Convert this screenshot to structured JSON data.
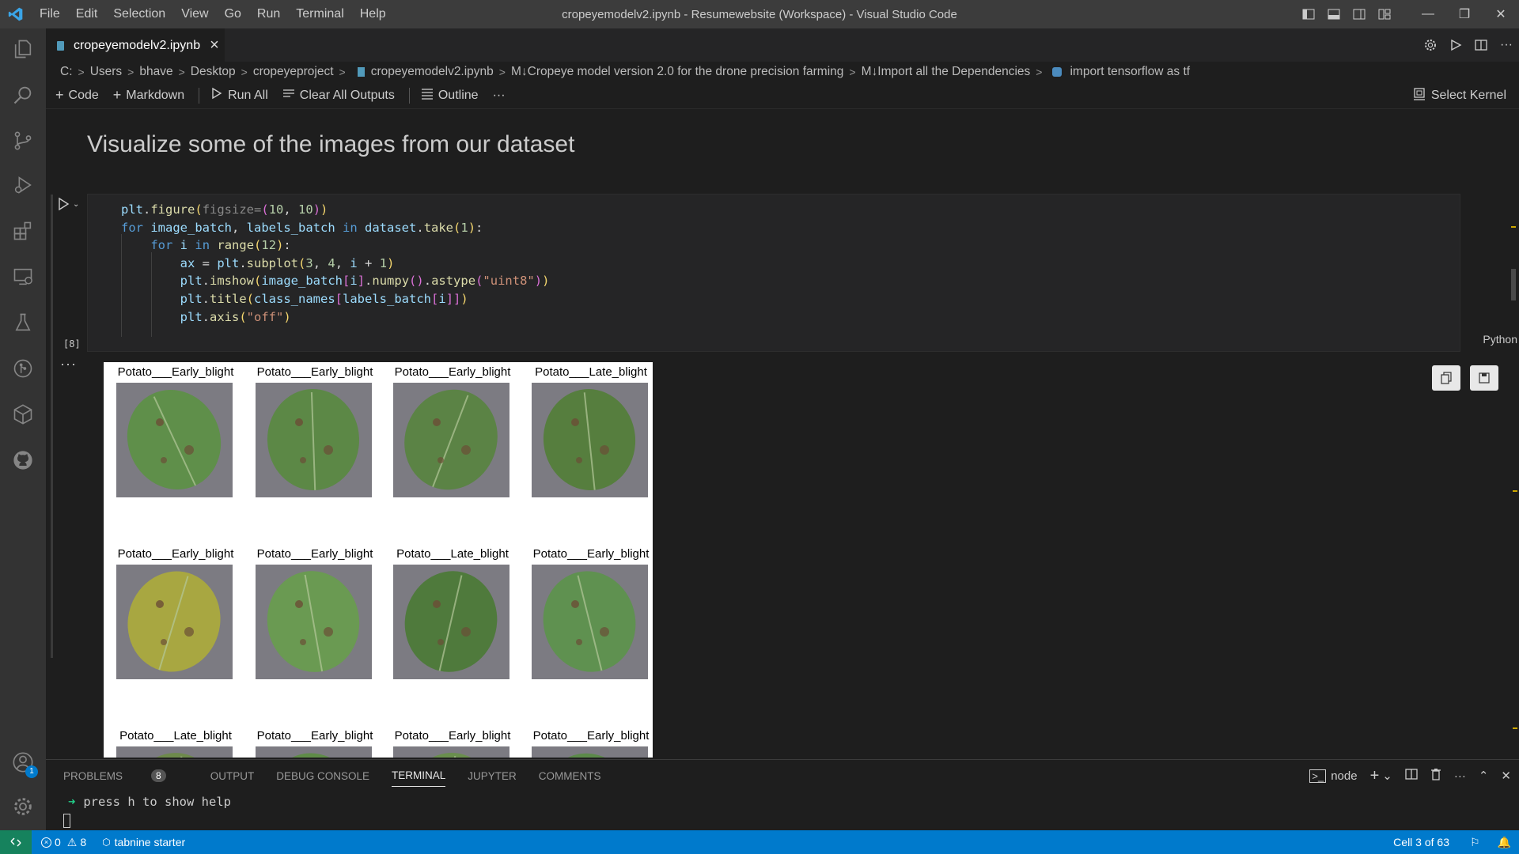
{
  "menu": [
    "File",
    "Edit",
    "Selection",
    "View",
    "Go",
    "Run",
    "Terminal",
    "Help"
  ],
  "window_title": "cropeyemodelv2.ipynb - Resumewebsite (Workspace) - Visual Studio Code",
  "tab": {
    "label": "cropeyemodelv2.ipynb",
    "close": "×"
  },
  "breadcrumb": [
    "C:",
    "Users",
    "bhave",
    "Desktop",
    "cropeyeproject",
    "cropeyemodelv2.ipynb",
    "M↓Cropeye model version 2.0 for the drone precision farming",
    "M↓Import all the Dependencies",
    "import tensorflow as tf"
  ],
  "toolbar": {
    "code": "Code",
    "markdown": "Markdown",
    "run_all": "Run All",
    "clear_outputs": "Clear All Outputs",
    "outline": "Outline",
    "more": "···",
    "kernel": "Select Kernel"
  },
  "markdown_heading": "Visualize some of the images from our dataset",
  "cell": {
    "exec_count": "[8]",
    "language": "Python",
    "output_more": "···"
  },
  "subplot_titles": [
    "Potato___Early_blight",
    "Potato___Early_blight",
    "Potato___Early_blight",
    "Potato___Late_blight",
    "Potato___Early_blight",
    "Potato___Early_blight",
    "Potato___Late_blight",
    "Potato___Early_blight",
    "Potato___Late_blight",
    "Potato___Early_blight",
    "Potato___Early_blight",
    "Potato___Early_blight"
  ],
  "panel": {
    "tabs": [
      "PROBLEMS",
      "OUTPUT",
      "DEBUG CONSOLE",
      "TERMINAL",
      "JUPYTER",
      "COMMENTS"
    ],
    "problems_count": "8",
    "shell": "node",
    "terminal_line": "press h to show help",
    "prompt": "➜"
  },
  "status": {
    "errors": "0",
    "warnings": "8",
    "tabnine": "tabnine starter",
    "cell": "Cell 3 of 63"
  },
  "accounts_badge": "1",
  "colors": {
    "accent": "#007acc",
    "remote": "#16825d"
  }
}
